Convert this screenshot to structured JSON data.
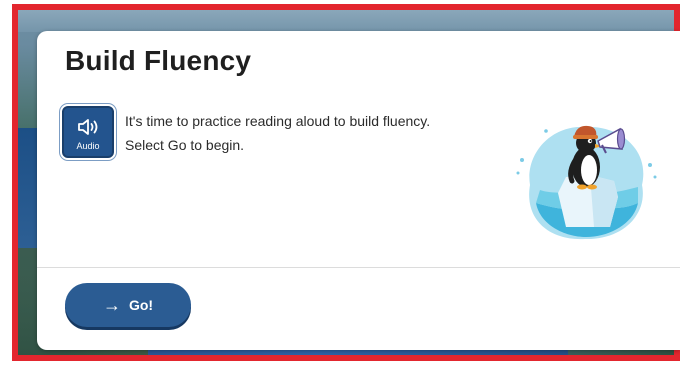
{
  "modal": {
    "title": "Build Fluency",
    "audio_button": {
      "label": "Audio",
      "icon": "speaker-icon"
    },
    "instructions": {
      "line1": "It's time to practice reading aloud to build fluency.",
      "line2": "Select Go to begin."
    },
    "illustration": "penguin-with-megaphone-on-iceberg",
    "go_button": {
      "label": "Go!",
      "icon": "arrow-right-icon"
    }
  },
  "colors": {
    "frame_border": "#e3262e",
    "primary_button": "#2b5c93",
    "audio_button": "#23548e",
    "title_text": "#1f1f1f"
  }
}
